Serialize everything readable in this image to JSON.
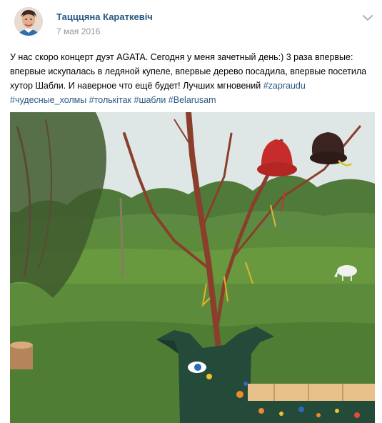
{
  "post": {
    "author_name": "Тацццяна Караткевіч",
    "date": "7 мая 2016",
    "text_plain": "У нас скоро концерт дуэт AGATA. Сегодня у меня зачетный день:) 3 раза впервые: впервые искупалась в ледяной купеле, впервые дерево посадила, впервые посетила хутор Шабли. И наверное что ещё будет! Лучших мгновений ",
    "hashtags": [
      "#zapraudu",
      "#чудесные_холмы",
      "#толькітак",
      "#шабли",
      "#Belarusam"
    ]
  },
  "icons": {
    "menu": "chevron-down-icon",
    "avatar": "user-avatar"
  },
  "colors": {
    "link": "#2a5885",
    "date": "#939393",
    "grass": "#5f8a3d"
  }
}
